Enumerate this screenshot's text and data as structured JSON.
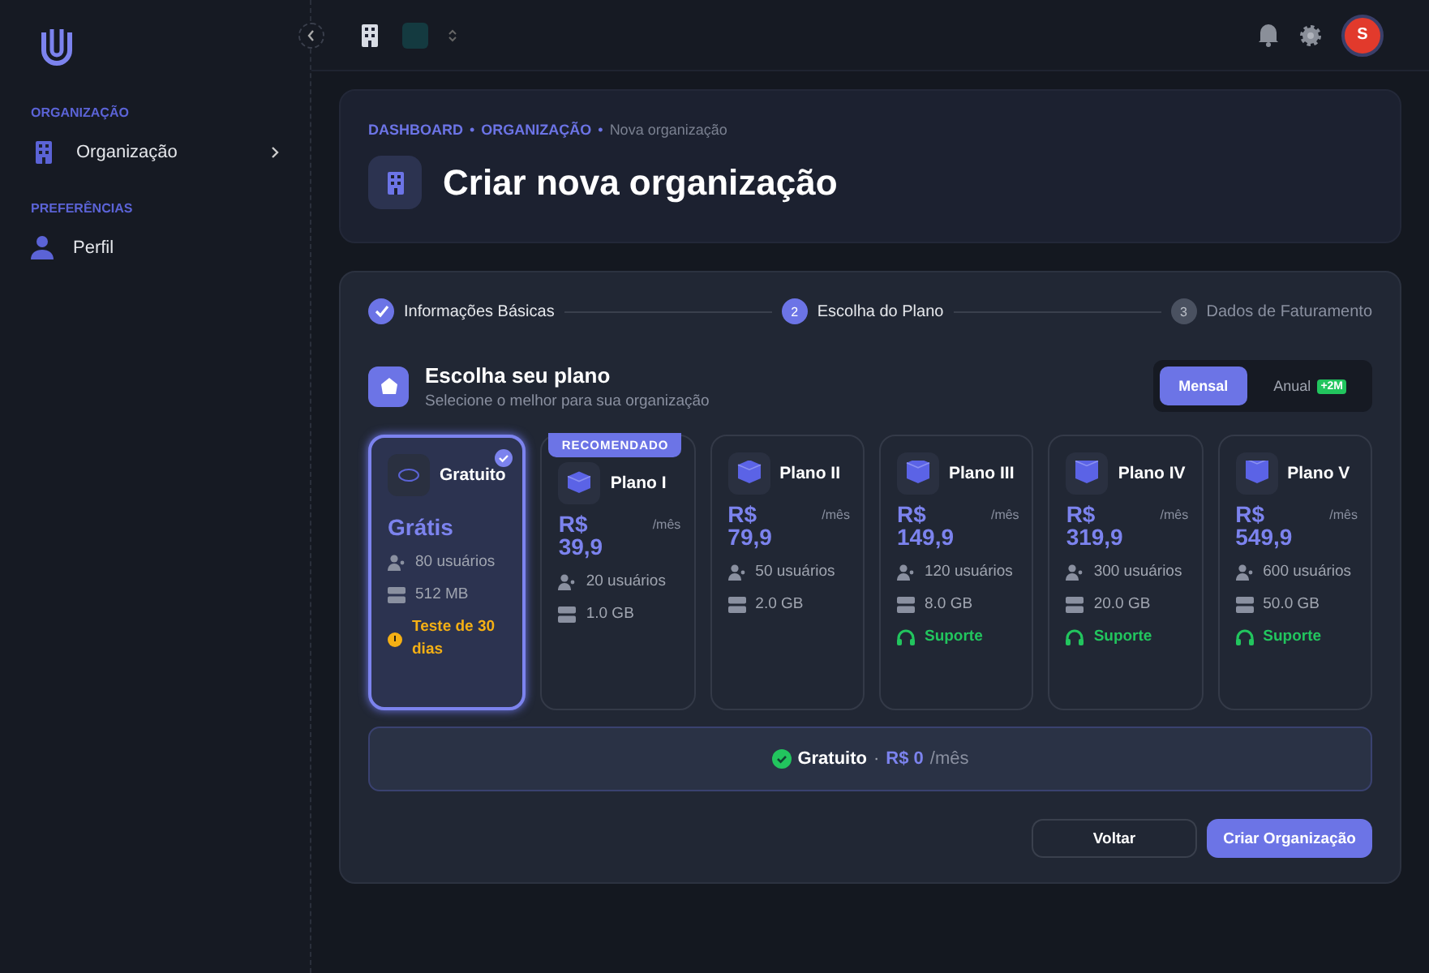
{
  "sidebar": {
    "sections": [
      {
        "title": "ORGANIZAÇÃO",
        "items": [
          {
            "label": "Organização",
            "kind": "organization",
            "expandable": true
          }
        ]
      },
      {
        "title": "PREFERÊNCIAS",
        "items": [
          {
            "label": "Perfil",
            "kind": "profile",
            "expandable": false
          }
        ]
      }
    ]
  },
  "topbar": {
    "avatar": "S"
  },
  "header": {
    "separator": "•",
    "breadcrumb": [
      {
        "label": "DASHBOARD",
        "kind": "link"
      },
      {
        "label": "ORGANIZAÇÃO",
        "kind": "link"
      },
      {
        "label": "Nova organização",
        "kind": "current"
      }
    ],
    "title": "Criar nova organização"
  },
  "steps": [
    {
      "label": "Informações Básicas",
      "kind": "done"
    },
    {
      "label": "Escolha do Plano",
      "number": "2",
      "kind": "current"
    },
    {
      "label": "Dados de Faturamento",
      "number": "3",
      "kind": "pending"
    }
  ],
  "plan_section": {
    "title": "Escolha seu plano",
    "subtitle": "Selecione o melhor para sua organização",
    "billing": [
      {
        "label": "Mensal",
        "selected": true
      },
      {
        "label": "Anual",
        "selected": false,
        "badge": "+2M"
      }
    ]
  },
  "plans": [
    {
      "name": "Gratuito",
      "price": "Grátis",
      "selected": true,
      "recommended": false,
      "features": [
        {
          "kind": "users",
          "text": "80 usuários"
        },
        {
          "kind": "storage",
          "text": "512 MB"
        },
        {
          "kind": "trial",
          "text": "Teste de 30 dias"
        }
      ]
    },
    {
      "name": "Plano I",
      "price": "R$ 39,9",
      "period": "/mês",
      "selected": false,
      "recommended": true,
      "badge": "RECOMENDADO",
      "features": [
        {
          "kind": "users",
          "text": "20 usuários"
        },
        {
          "kind": "storage",
          "text": "1.0 GB"
        }
      ]
    },
    {
      "name": "Plano II",
      "price": "R$ 79,9",
      "period": "/mês",
      "selected": false,
      "recommended": false,
      "features": [
        {
          "kind": "users",
          "text": "50 usuários"
        },
        {
          "kind": "storage",
          "text": "2.0 GB"
        }
      ]
    },
    {
      "name": "Plano III",
      "price": "R$ 149,9",
      "period": "/mês",
      "selected": false,
      "recommended": false,
      "features": [
        {
          "kind": "users",
          "text": "120 usuários"
        },
        {
          "kind": "storage",
          "text": "8.0 GB"
        },
        {
          "kind": "support",
          "text": "Suporte"
        }
      ]
    },
    {
      "name": "Plano IV",
      "price": "R$ 319,9",
      "period": "/mês",
      "selected": false,
      "recommended": false,
      "features": [
        {
          "kind": "users",
          "text": "300 usuários"
        },
        {
          "kind": "storage",
          "text": "20.0 GB"
        },
        {
          "kind": "support",
          "text": "Suporte"
        }
      ]
    },
    {
      "name": "Plano V",
      "price": "R$ 549,9",
      "period": "/mês",
      "selected": false,
      "recommended": false,
      "features": [
        {
          "kind": "users",
          "text": "600 usuários"
        },
        {
          "kind": "storage",
          "text": "50.0 GB"
        },
        {
          "kind": "support",
          "text": "Suporte"
        }
      ]
    }
  ],
  "summary": {
    "name": "Gratuito",
    "separator": "·",
    "price": "R$ 0",
    "period": "/mês"
  },
  "buttons": [
    {
      "label": "Voltar",
      "kind": "secondary"
    },
    {
      "label": "Criar Organização",
      "kind": "primary"
    }
  ]
}
